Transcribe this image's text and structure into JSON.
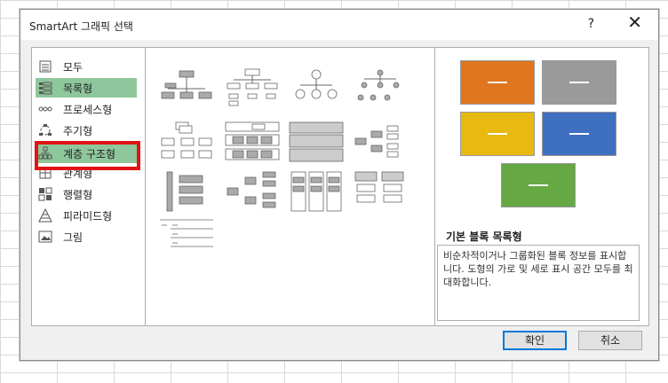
{
  "dialog": {
    "title": "SmartArt 그래픽 선택",
    "help": "?",
    "close": "✕"
  },
  "categories": [
    {
      "label": "모두",
      "icon": "all-icon"
    },
    {
      "label": "목록형",
      "icon": "list-icon"
    },
    {
      "label": "프로세스형",
      "icon": "process-icon"
    },
    {
      "label": "주기형",
      "icon": "cycle-icon"
    },
    {
      "label": "계층 구조형",
      "icon": "hierarchy-icon"
    },
    {
      "label": "관계형",
      "icon": "relationship-icon"
    },
    {
      "label": "행렬형",
      "icon": "matrix-icon"
    },
    {
      "label": "피라미드형",
      "icon": "pyramid-icon"
    },
    {
      "label": "그림",
      "icon": "picture-icon"
    }
  ],
  "selected_category": "계층 구조형",
  "preview": {
    "title": "기본 블록 목록형",
    "description": "비순차적이거나 그룹화된 블록 정보를 표시합니다. 도형의 가로 및 세로 표시 공간 모두를 최대화합니다.",
    "colors": [
      "#e0761f",
      "#9a9a9a",
      "#e8b910",
      "#3f6fbf",
      "#65a844"
    ]
  },
  "buttons": {
    "ok": "확인",
    "cancel": "취소"
  }
}
